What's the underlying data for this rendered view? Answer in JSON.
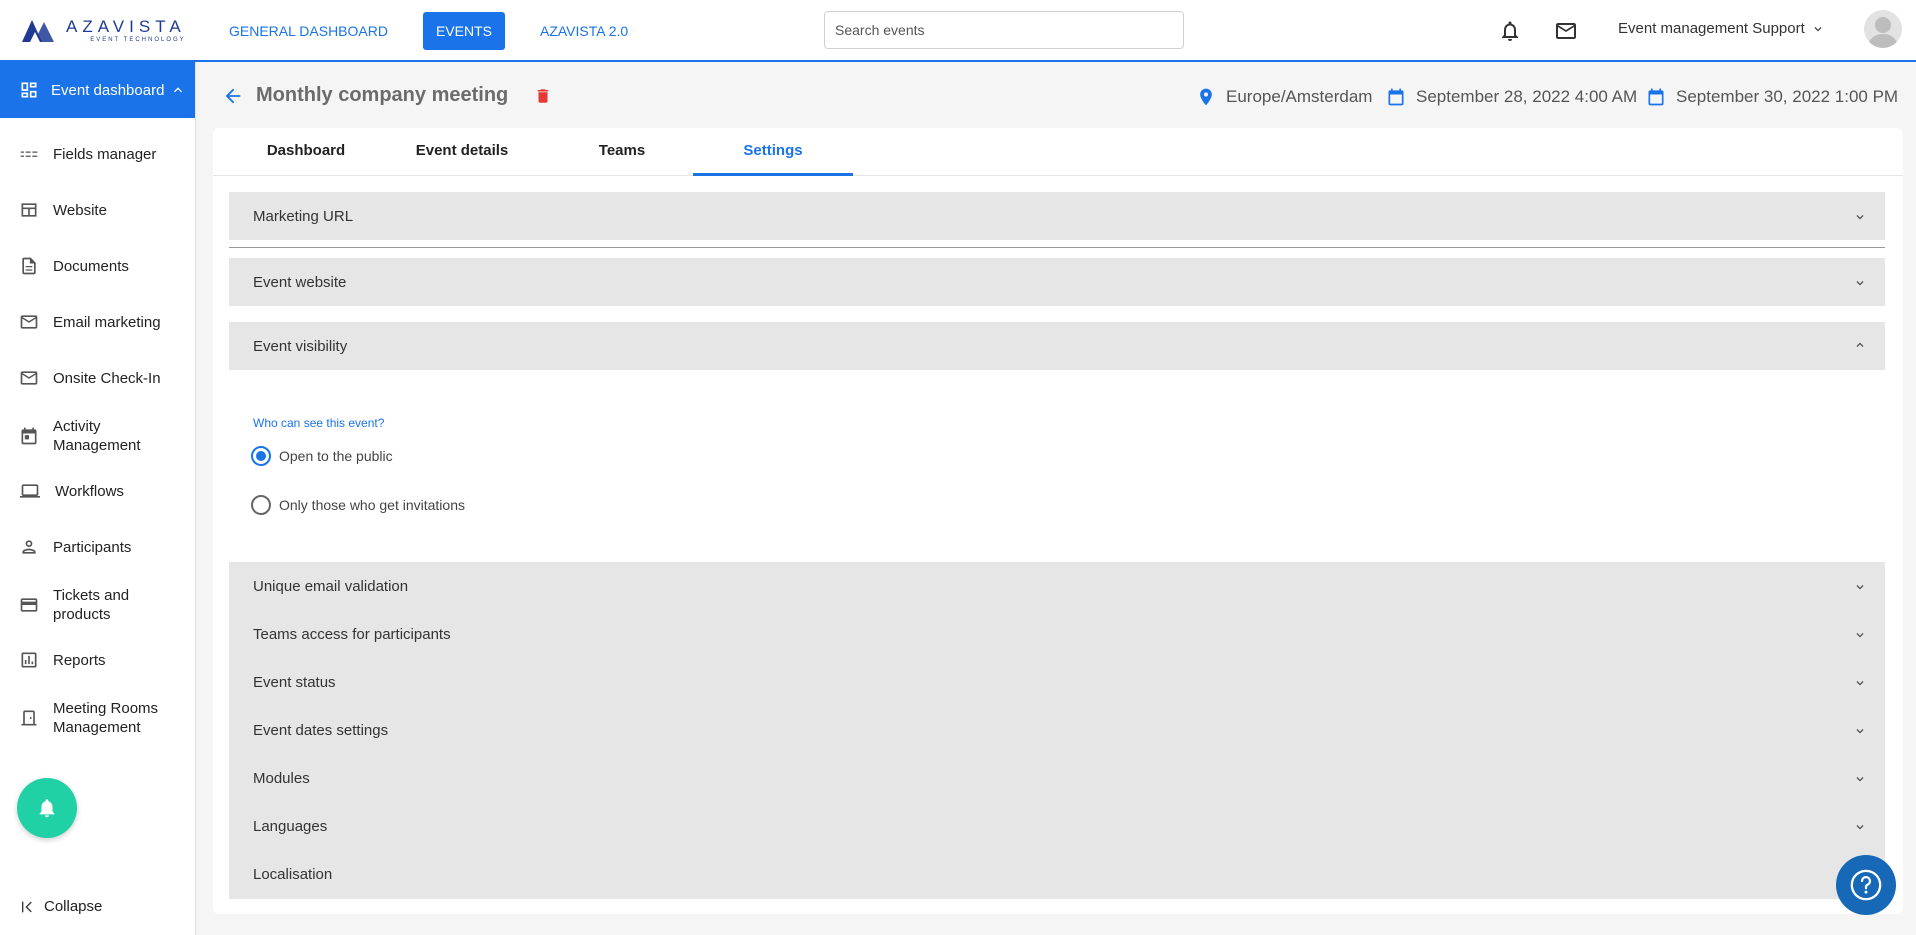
{
  "brand": {
    "name": "AZAVISTA",
    "tagline": "EVENT TECHNOLOGY",
    "color": "#1f3a93"
  },
  "topnav": {
    "items": [
      {
        "label": "GENERAL DASHBOARD",
        "active": false
      },
      {
        "label": "EVENTS",
        "active": true
      },
      {
        "label": "AZAVISTA 2.0",
        "active": false
      }
    ],
    "search_placeholder": "Search events",
    "user_label": "Event management Support"
  },
  "sidebar": {
    "header": "Event dashboard",
    "items": [
      {
        "label": "Fields manager",
        "icon": "fields-icon"
      },
      {
        "label": "Website",
        "icon": "website-icon"
      },
      {
        "label": "Documents",
        "icon": "document-icon"
      },
      {
        "label": "Email marketing",
        "icon": "mail-icon"
      },
      {
        "label": "Onsite Check-In",
        "icon": "mail-icon"
      },
      {
        "label": "Activity Management",
        "icon": "calendar-icon"
      },
      {
        "label": "Workflows",
        "icon": "laptop-icon"
      },
      {
        "label": "Participants",
        "icon": "person-icon"
      },
      {
        "label": "Tickets and products",
        "icon": "card-icon"
      },
      {
        "label": "Reports",
        "icon": "chart-icon"
      },
      {
        "label": "Meeting Rooms Management",
        "icon": "door-icon"
      }
    ],
    "collapse_label": "Collapse"
  },
  "event": {
    "title": "Monthly company meeting",
    "timezone": "Europe/Amsterdam",
    "start": "September 28, 2022 4:00 AM",
    "end": "September 30, 2022 1:00 PM"
  },
  "tabs": [
    {
      "label": "Dashboard",
      "active": false
    },
    {
      "label": "Event details",
      "active": false
    },
    {
      "label": "Teams",
      "active": false
    },
    {
      "label": "Settings",
      "active": true
    }
  ],
  "settings": {
    "sections_top": [
      "Marketing URL",
      "Event website",
      "Event visibility"
    ],
    "visibility": {
      "question": "Who can see this event?",
      "options": [
        {
          "label": "Open to the public",
          "checked": true
        },
        {
          "label": "Only those who get invitations",
          "checked": false
        }
      ]
    },
    "sections_bottom": [
      "Unique email validation",
      "Teams access for participants",
      "Event status",
      "Event dates settings",
      "Modules",
      "Languages",
      "Localisation"
    ]
  },
  "colors": {
    "accent": "#1a73e8",
    "danger": "#e53935",
    "notify": "#1fd1a4",
    "help": "#1769b8"
  }
}
